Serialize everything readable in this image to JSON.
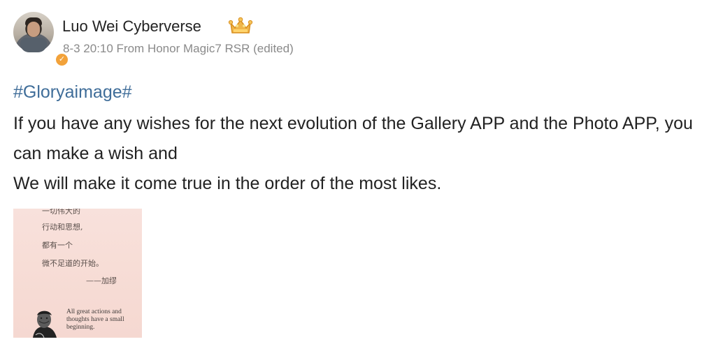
{
  "post": {
    "author": "Luo Wei Cyberverse",
    "meta": "8-3 20:10 From Honor Magic7 RSR (edited)",
    "hashtag": "#Gloryaimage#",
    "lines": [
      "If you have any wishes for the next evolution of the Gallery APP and the Photo APP, you can make a wish and",
      "We will make it come true in the order of the most likes."
    ]
  },
  "image": {
    "zh_lines": [
      "一切伟大的",
      "行动和思想,",
      "都有一个",
      "微不足道的开始。",
      "——加缪"
    ],
    "en_quote": "All great actions and thoughts have a small beginning."
  },
  "colors": {
    "hashtag": "#3f6d99",
    "meta": "#8a8a8a",
    "badge": "#f2a23a",
    "crown": "#f0b64a"
  },
  "icons": {
    "crown": "crown-icon",
    "verified": "verified-badge-icon"
  }
}
